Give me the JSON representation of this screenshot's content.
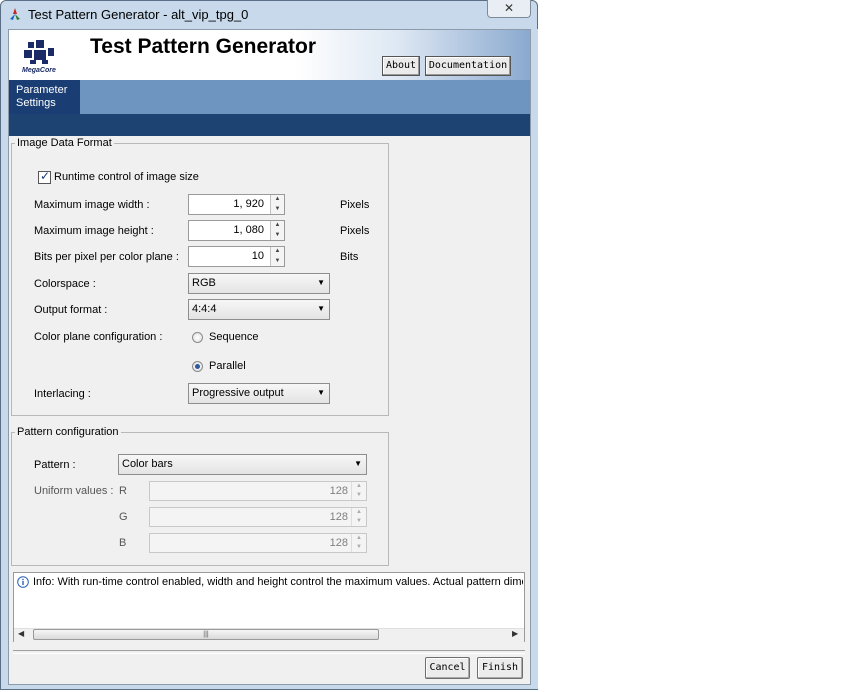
{
  "window": {
    "title": "Test Pattern Generator - alt_vip_tpg_0",
    "close_label": "✕"
  },
  "banner": {
    "title": "Test Pattern Generator",
    "logo_text": "MegaCore",
    "about_label": "About",
    "documentation_label": "Documentation"
  },
  "tabs": [
    {
      "label": "Parameter Settings",
      "active": true
    }
  ],
  "image_data_format": {
    "legend": "Image Data Format",
    "runtime_control": {
      "label": "Runtime control of image size",
      "checked": true
    },
    "max_width": {
      "label": "Maximum image width :",
      "value": "1, 920",
      "unit": "Pixels"
    },
    "max_height": {
      "label": "Maximum image height :",
      "value": "1, 080",
      "unit": "Pixels"
    },
    "bits_per_pixel": {
      "label": "Bits per pixel per color plane :",
      "value": "10",
      "unit": "Bits"
    },
    "colorspace": {
      "label": "Colorspace :",
      "value": "RGB"
    },
    "output_format": {
      "label": "Output format :",
      "value": "4:4:4"
    },
    "color_plane_config": {
      "label": "Color plane configuration :",
      "options": [
        "Sequence",
        "Parallel"
      ],
      "selected": "Parallel"
    },
    "interlacing": {
      "label": "Interlacing :",
      "value": "Progressive output"
    }
  },
  "pattern_configuration": {
    "legend": "Pattern configuration",
    "pattern": {
      "label": "Pattern :",
      "value": "Color bars"
    },
    "uniform_values": {
      "label": "Uniform values :",
      "r": {
        "label": "R",
        "value": "128"
      },
      "g": {
        "label": "G",
        "value": "128"
      },
      "b": {
        "label": "B",
        "value": "128"
      }
    }
  },
  "info": {
    "message": "Info: With run-time control enabled, width and height control the maximum values. Actual pattern dimensions"
  },
  "footer": {
    "cancel_label": "Cancel",
    "finish_label": "Finish"
  },
  "colors": {
    "banner_blue": "#1d4372",
    "tab_strip": "#6d95c0",
    "window_frame": "#c7d9ea"
  }
}
